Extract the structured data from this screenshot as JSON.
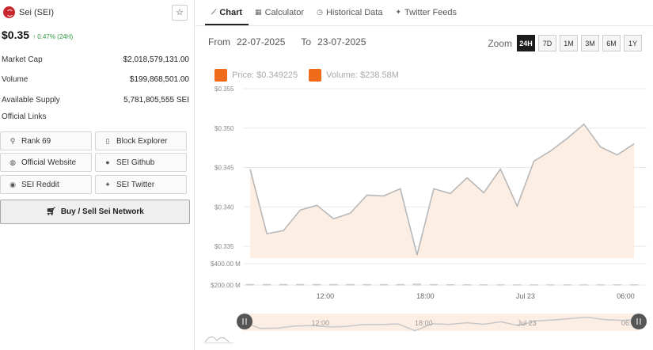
{
  "coin": {
    "name": "Sei (SEI)",
    "price": "$0.35",
    "change": "↑ 0.47% (24H)"
  },
  "stats": [
    {
      "label": "Market Cap",
      "value": "$2,018,579,131.00"
    },
    {
      "label": "Volume",
      "value": "$199,868,501.00"
    },
    {
      "label": "Available Supply",
      "value": "5,781,805,555 SEI"
    }
  ],
  "links_title": "Official Links",
  "links": {
    "rank": "Rank 69",
    "block_explorer": "Block Explorer",
    "website": "Official Website",
    "github": "SEI Github",
    "reddit": "SEI Reddit",
    "twitter": "SEI Twitter"
  },
  "buy_label": "Buy / Sell Sei Network",
  "tabs": [
    {
      "label": "Chart",
      "icon": "line-chart-icon"
    },
    {
      "label": "Calculator",
      "icon": "calculator-icon"
    },
    {
      "label": "Historical Data",
      "icon": "history-icon"
    },
    {
      "label": "Twitter Feeds",
      "icon": "twitter-icon"
    }
  ],
  "range": {
    "from_label": "From",
    "from": "22-07-2025",
    "to_label": "To",
    "to": "23-07-2025"
  },
  "zoom": {
    "label": "Zoom",
    "options": [
      "24H",
      "7D",
      "1M",
      "3M",
      "6M",
      "1Y"
    ],
    "active": "24H"
  },
  "legend": {
    "price": "Price: $0.349225",
    "volume": "Volume: $238.58M"
  },
  "colors": {
    "accent": "#ef6b1a",
    "area_fill": "#fdeee4",
    "line": "#b8b8b8",
    "up": "#2e9a3e"
  },
  "chart_data": {
    "type": "area",
    "price_axis": {
      "ticks": [
        "$0.355",
        "$0.350",
        "$0.345",
        "$0.340",
        "$0.335"
      ],
      "tick_values": [
        0.355,
        0.35,
        0.345,
        0.34,
        0.335
      ],
      "ylim": [
        0.3335,
        0.355
      ]
    },
    "price": [
      0.3448,
      0.3366,
      0.337,
      0.3396,
      0.3402,
      0.3385,
      0.3392,
      0.3415,
      0.3414,
      0.3423,
      0.3339,
      0.3423,
      0.3417,
      0.3437,
      0.3418,
      0.3448,
      0.3401,
      0.3458,
      0.3471,
      0.3487,
      0.3505,
      0.3476,
      0.3466,
      0.348
    ],
    "volume_axis": {
      "ticks": [
        "$400.00 M",
        "$200.00 M"
      ],
      "tick_values": [
        400,
        200
      ],
      "ylim": [
        200,
        400
      ]
    },
    "volume_musd": [
      206,
      206,
      206,
      206,
      206,
      206,
      206,
      205,
      205,
      205,
      210,
      205,
      204,
      203,
      203,
      202,
      202,
      202,
      202,
      202,
      202,
      202,
      203,
      203
    ],
    "x_ticks": [
      "12:00",
      "18:00",
      "Jul 23",
      "06:00"
    ],
    "x_tick_positions": [
      4.5,
      10.5,
      16.5,
      22.5
    ]
  }
}
